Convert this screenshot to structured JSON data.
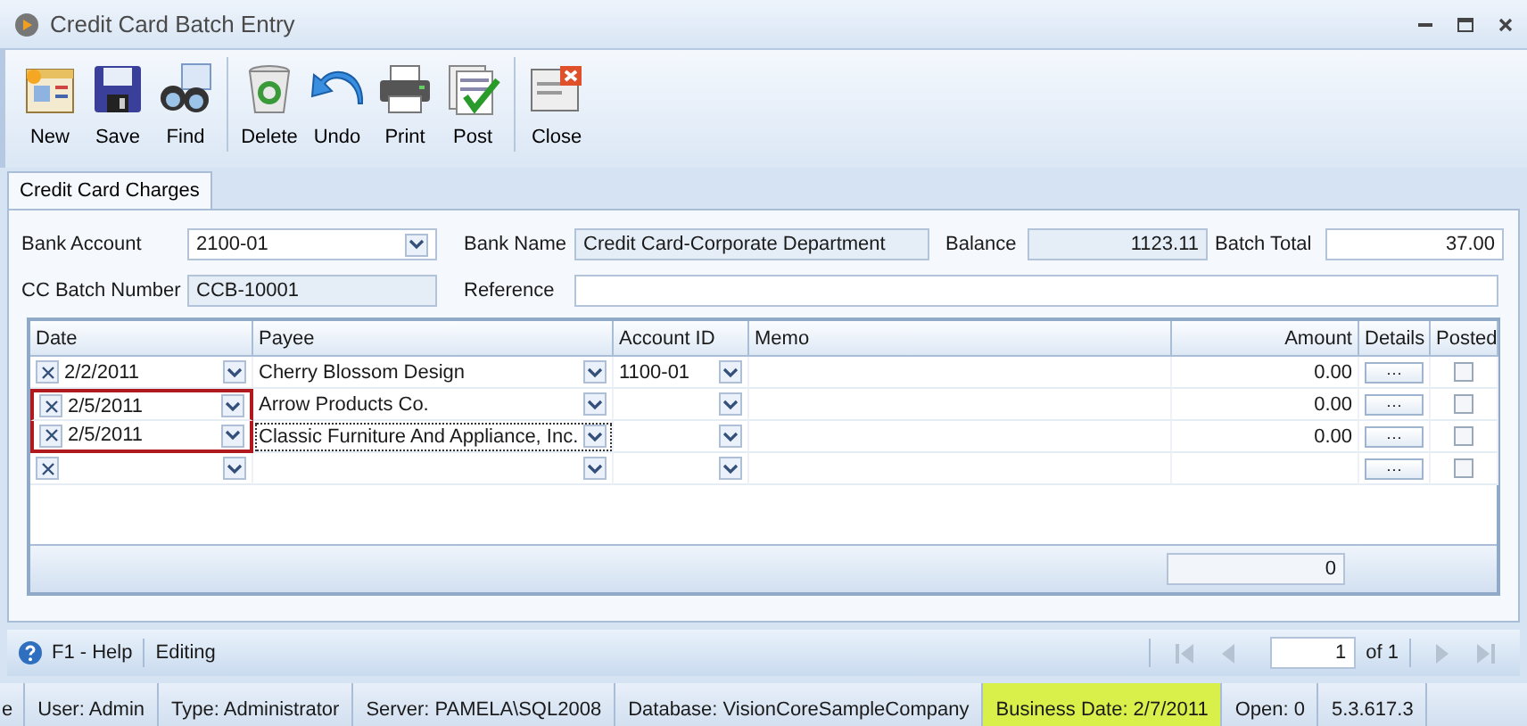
{
  "window": {
    "title": "Credit Card Batch Entry"
  },
  "toolbar": [
    {
      "kind": "new",
      "label": "New",
      "separated": false
    },
    {
      "kind": "save",
      "label": "Save",
      "separated": false
    },
    {
      "kind": "find",
      "label": "Find",
      "separated": false
    },
    {
      "kind": "delete",
      "label": "Delete",
      "separated": true
    },
    {
      "kind": "undo",
      "label": "Undo",
      "separated": false
    },
    {
      "kind": "print",
      "label": "Print",
      "separated": false
    },
    {
      "kind": "post",
      "label": "Post",
      "separated": false
    },
    {
      "kind": "close",
      "label": "Close",
      "separated": true
    }
  ],
  "tabs": [
    {
      "label": "Credit Card Charges",
      "selected": true
    }
  ],
  "form": {
    "bank_account": {
      "label": "Bank Account",
      "value": "2100-01"
    },
    "bank_name": {
      "label": "Bank Name",
      "value": "Credit Card-Corporate Department"
    },
    "balance": {
      "label": "Balance",
      "value": "1123.11"
    },
    "batch_total": {
      "label": "Batch Total",
      "value": "37.00"
    },
    "cc_batch_number": {
      "label": "CC Batch Number",
      "value": "CCB-10001"
    },
    "reference": {
      "label": "Reference"
    }
  },
  "grid": {
    "columns": [
      "Date",
      "Payee",
      "Account ID",
      "Memo",
      "Amount",
      "Details",
      "Posted"
    ],
    "rows": [
      {
        "date": "2/2/2011",
        "payee": "Cherry Blossom Design",
        "account_id": "1100-01",
        "amount": "0.00",
        "details": "···",
        "posted": false,
        "highlighted": false,
        "focused": false
      },
      {
        "date": "2/5/2011",
        "payee": "Arrow Products Co.",
        "amount": "0.00",
        "details": "···",
        "posted": false,
        "highlighted": true,
        "focused": false
      },
      {
        "date": "2/5/2011",
        "payee": "Classic Furniture And Appliance, Inc.",
        "amount": "0.00",
        "details": "···",
        "posted": false,
        "highlighted": true,
        "focused": true
      },
      {
        "details": "···",
        "posted": false,
        "highlighted": false,
        "focused": false
      }
    ],
    "footer_total": "0"
  },
  "nav": {
    "help": "F1 - Help",
    "mode": "Editing",
    "page": "1",
    "of": "of 1"
  },
  "status_bar": [
    {
      "text": "e",
      "highlighted": false
    },
    {
      "text": "User: Admin",
      "highlighted": false
    },
    {
      "text": "Type: Administrator",
      "highlighted": false
    },
    {
      "text": "Server: PAMELA\\SQL2008",
      "highlighted": false
    },
    {
      "text": "Database: VisionCoreSampleCompany",
      "highlighted": false
    },
    {
      "text": "Business Date: 2/7/2011",
      "highlighted": true
    },
    {
      "text": "Open: 0",
      "highlighted": false
    },
    {
      "text": "5.3.617.3",
      "highlighted": false
    }
  ]
}
